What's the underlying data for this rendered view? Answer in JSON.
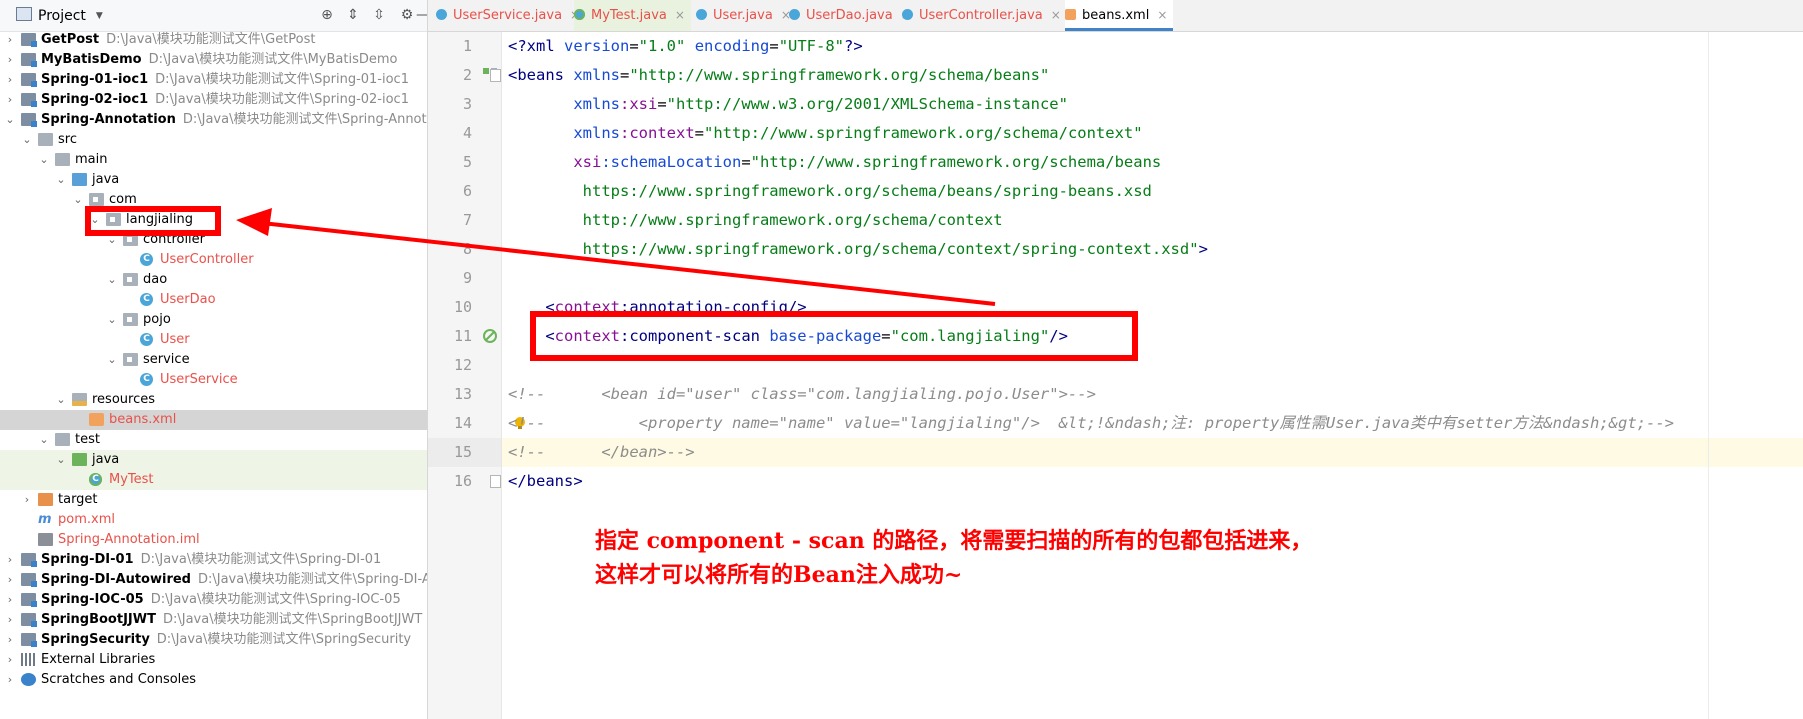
{
  "project_panel": {
    "title": "Project",
    "tree": [
      {
        "label": "GetPost",
        "path": "D:\\Java\\模块功能测试文件\\GetPost",
        "bold": true,
        "arrow": "›",
        "icon": "modfolder",
        "indent": 0
      },
      {
        "label": "MyBatisDemo",
        "path": "D:\\Java\\模块功能测试文件\\MyBatisDemo",
        "bold": true,
        "arrow": "›",
        "icon": "modfolder",
        "indent": 0
      },
      {
        "label": "Spring-01-ioc1",
        "path": "D:\\Java\\模块功能测试文件\\Spring-01-ioc1",
        "bold": true,
        "arrow": "›",
        "icon": "modfolder",
        "indent": 0
      },
      {
        "label": "Spring-02-ioc1",
        "path": "D:\\Java\\模块功能测试文件\\Spring-02-ioc1",
        "bold": true,
        "arrow": "›",
        "icon": "modfolder",
        "indent": 0
      },
      {
        "label": "Spring-Annotation",
        "path": "D:\\Java\\模块功能测试文件\\Spring-Annotation",
        "bold": true,
        "arrow": "⌄",
        "icon": "modfolder",
        "indent": 0
      },
      {
        "label": "src",
        "path": "",
        "arrow": "⌄",
        "icon": "folder",
        "indent": 1
      },
      {
        "label": "main",
        "path": "",
        "arrow": "⌄",
        "icon": "folder",
        "indent": 2
      },
      {
        "label": "java",
        "path": "",
        "arrow": "⌄",
        "icon": "srcfolder",
        "indent": 3
      },
      {
        "label": "com",
        "path": "",
        "arrow": "⌄",
        "icon": "pkg",
        "indent": 4
      },
      {
        "label": "langjialing",
        "path": "",
        "arrow": "⌄",
        "icon": "pkg",
        "indent": 5
      },
      {
        "label": "controller",
        "path": "",
        "arrow": "⌄",
        "icon": "pkg",
        "indent": 6
      },
      {
        "label": "UserController",
        "path": "",
        "arrow": "",
        "icon": "class",
        "indent": 7,
        "red": true
      },
      {
        "label": "dao",
        "path": "",
        "arrow": "⌄",
        "icon": "pkg",
        "indent": 6
      },
      {
        "label": "UserDao",
        "path": "",
        "arrow": "",
        "icon": "class",
        "indent": 7,
        "red": true
      },
      {
        "label": "pojo",
        "path": "",
        "arrow": "⌄",
        "icon": "pkg",
        "indent": 6
      },
      {
        "label": "User",
        "path": "",
        "arrow": "",
        "icon": "class",
        "indent": 7,
        "red": true
      },
      {
        "label": "service",
        "path": "",
        "arrow": "⌄",
        "icon": "pkg",
        "indent": 6
      },
      {
        "label": "UserService",
        "path": "",
        "arrow": "",
        "icon": "class",
        "indent": 7,
        "red": true
      },
      {
        "label": "resources",
        "path": "",
        "arrow": "⌄",
        "icon": "res",
        "indent": 3
      },
      {
        "label": "beans.xml",
        "path": "",
        "arrow": "",
        "icon": "xml",
        "indent": 4,
        "red": true,
        "selected": true
      },
      {
        "label": "test",
        "path": "",
        "arrow": "⌄",
        "icon": "folder",
        "indent": 2
      },
      {
        "label": "java",
        "path": "",
        "arrow": "⌄",
        "icon": "testfolder",
        "indent": 3,
        "highlight": true
      },
      {
        "label": "MyTest",
        "path": "",
        "arrow": "",
        "icon": "classtest",
        "indent": 4,
        "red": true,
        "highlight": true
      },
      {
        "label": "target",
        "path": "",
        "arrow": "›",
        "icon": "exclfolder",
        "indent": 1
      },
      {
        "label": "pom.xml",
        "path": "",
        "arrow": "",
        "icon": "maven",
        "indent": 1,
        "red": true
      },
      {
        "label": "Spring-Annotation.iml",
        "path": "",
        "arrow": "",
        "icon": "iml",
        "indent": 1,
        "red": true
      },
      {
        "label": "Spring-DI-01",
        "path": "D:\\Java\\模块功能测试文件\\Spring-DI-01",
        "bold": true,
        "arrow": "›",
        "icon": "modfolder",
        "indent": 0
      },
      {
        "label": "Spring-DI-Autowired",
        "path": "D:\\Java\\模块功能测试文件\\Spring-DI-Autowi",
        "bold": true,
        "arrow": "›",
        "icon": "modfolder",
        "indent": 0
      },
      {
        "label": "Spring-IOC-05",
        "path": "D:\\Java\\模块功能测试文件\\Spring-IOC-05",
        "bold": true,
        "arrow": "›",
        "icon": "modfolder",
        "indent": 0
      },
      {
        "label": "SpringBootJJWT",
        "path": "D:\\Java\\模块功能测试文件\\SpringBootJJWT",
        "bold": true,
        "arrow": "›",
        "icon": "modfolder",
        "indent": 0
      },
      {
        "label": "SpringSecurity",
        "path": "D:\\Java\\模块功能测试文件\\SpringSecurity",
        "bold": true,
        "arrow": "›",
        "icon": "modfolder",
        "indent": 0
      },
      {
        "label": "External Libraries",
        "path": "",
        "arrow": "›",
        "icon": "lib",
        "indent": 0
      },
      {
        "label": "Scratches and Consoles",
        "path": "",
        "arrow": "›",
        "icon": "scratch",
        "indent": 0
      }
    ]
  },
  "editor": {
    "tabs": [
      {
        "label": "UserService.java",
        "icon": "class"
      },
      {
        "label": "MyTest.java",
        "icon": "classtest"
      },
      {
        "label": "User.java",
        "icon": "class"
      },
      {
        "label": "UserDao.java",
        "icon": "class"
      },
      {
        "label": "UserController.java",
        "icon": "class"
      },
      {
        "label": "beans.xml",
        "icon": "xml",
        "active": true
      }
    ],
    "close_glyph": "×",
    "line_numbers": [
      "1",
      "2",
      "3",
      "4",
      "5",
      "6",
      "7",
      "8",
      "9",
      "10",
      "11",
      "12",
      "13",
      "14",
      "15",
      "16"
    ],
    "code_lines": [
      [
        [
          "pi",
          "<?xml "
        ],
        [
          "at",
          "version"
        ],
        [
          "pl",
          "="
        ],
        [
          "st",
          "\"1.0\""
        ],
        [
          "pl",
          " "
        ],
        [
          "at",
          "encoding"
        ],
        [
          "pl",
          "="
        ],
        [
          "st",
          "\"UTF-8\""
        ],
        [
          "pi",
          "?>"
        ]
      ],
      [
        [
          "tg",
          "<beans "
        ],
        [
          "at",
          "xmlns"
        ],
        [
          "pl",
          "="
        ],
        [
          "st",
          "\"http://www.springframework.org/schema/beans\""
        ]
      ],
      [
        [
          "pl",
          "       "
        ],
        [
          "at",
          "xmlns"
        ],
        [
          "ns",
          ":xsi"
        ],
        [
          "pl",
          "="
        ],
        [
          "st",
          "\"http://www.w3.org/2001/XMLSchema-instance\""
        ]
      ],
      [
        [
          "pl",
          "       "
        ],
        [
          "at",
          "xmlns"
        ],
        [
          "ns",
          ":context"
        ],
        [
          "pl",
          "="
        ],
        [
          "st",
          "\"http://www.springframework.org/schema/context\""
        ]
      ],
      [
        [
          "pl",
          "       "
        ],
        [
          "ns",
          "xsi"
        ],
        [
          "at",
          ":schemaLocation"
        ],
        [
          "pl",
          "="
        ],
        [
          "st",
          "\"http://www.springframework.org/schema/beans"
        ]
      ],
      [
        [
          "st",
          "        https://www.springframework.org/schema/beans/spring-beans.xsd"
        ]
      ],
      [
        [
          "st",
          "        http://www.springframework.org/schema/context"
        ]
      ],
      [
        [
          "st",
          "        https://www.springframework.org/schema/context/spring-context.xsd\""
        ],
        [
          "tg",
          ">"
        ]
      ],
      [
        [
          "pl",
          ""
        ]
      ],
      [
        [
          "tg",
          "    <"
        ],
        [
          "ns",
          "context"
        ],
        [
          "tg",
          ":annotation-config/>"
        ]
      ],
      [
        [
          "tg",
          "    <"
        ],
        [
          "ns",
          "context"
        ],
        [
          "tg",
          ":component-scan "
        ],
        [
          "at",
          "base-package"
        ],
        [
          "pl",
          "="
        ],
        [
          "st",
          "\"com.langjialing\""
        ],
        [
          "tg",
          "/>"
        ]
      ],
      [
        [
          "pl",
          ""
        ]
      ],
      [
        [
          "cm",
          "<!--      <bean id=\"user\" class=\"com.langjialing.pojo.User\">-->"
        ]
      ],
      [
        [
          "cm",
          "<!--          <property name=\"name\" value=\"langjialing\"/>  &lt;!&ndash;注: property属性需User.java类中有setter方法&ndash;&gt;-->"
        ]
      ],
      [
        [
          "cm",
          "<!--      </bean>-->"
        ]
      ],
      [
        [
          "tg",
          "</beans>"
        ]
      ]
    ],
    "current_line": 15
  },
  "annotation": {
    "line1": "指定 component - scan 的路径，将需要扫描的所有的包都包括进来，",
    "line2": "这样才可以将所有的Bean注入成功~",
    "color": "#ff0000"
  }
}
